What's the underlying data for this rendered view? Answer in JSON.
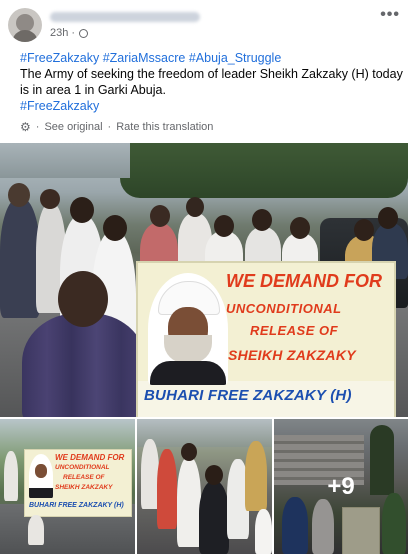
{
  "post": {
    "time": "23h ·",
    "privacy_icon": "globe-icon",
    "more_icon": "more-options-icon",
    "hashtags_top": [
      "#FreeZakzaky",
      "#ZariaMssacre",
      "#Abuja_Struggle"
    ],
    "body": "The Army of seeking the freedom of leader Sheikh Zakzaky (H) today is in area 1 in Garki Abuja.",
    "hashtag_bottom": "#FreeZakzaky",
    "see_original": "See original",
    "rate_translation": "Rate this translation",
    "separator": "·"
  },
  "banner": {
    "line1": "WE DEMAND FOR",
    "line2": "UNCONDITIONAL",
    "line3": "RELEASE OF",
    "line4": "SHEIKH ZAKZAKY",
    "line5": "BUHARI FREE ZAKZAKY (H)"
  },
  "small_banner": {
    "line1": "WE DEMAND FOR",
    "line2": "UNCONDITIONAL",
    "line3": "RELEASE OF",
    "line4": "SHEIKH ZAKZAKY",
    "line5": "BUHARI FREE ZAKZAKY (H)"
  },
  "more_photos": "+9",
  "colors": {
    "hashtag": "#216fdb",
    "meta": "#65676b",
    "banner_red": "#e03b1c",
    "banner_blue": "#1c4fb0"
  }
}
